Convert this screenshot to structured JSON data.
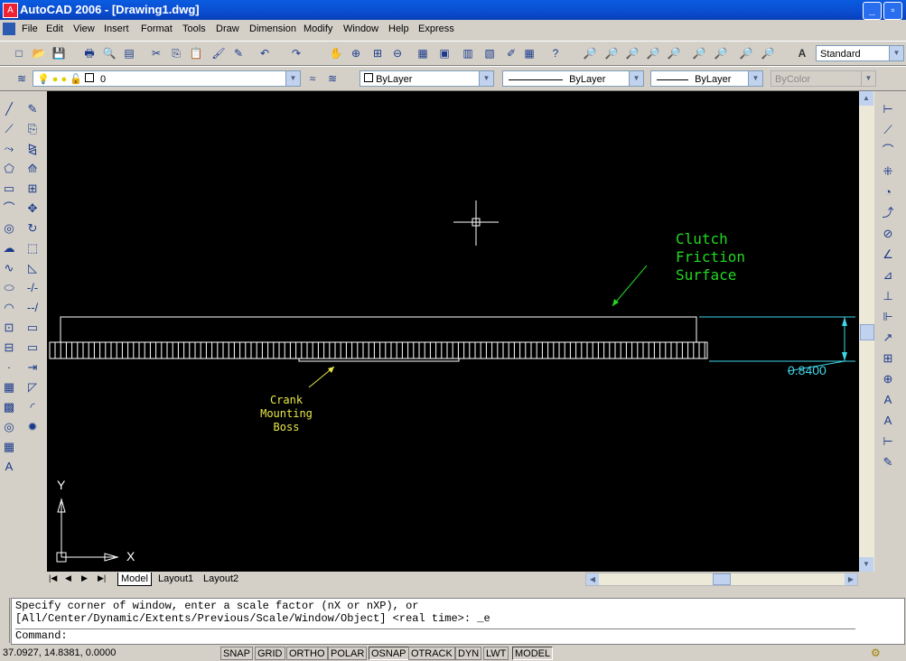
{
  "title": "AutoCAD 2006 - [Drawing1.dwg]",
  "menu": [
    "File",
    "Edit",
    "View",
    "Insert",
    "Format",
    "Tools",
    "Draw",
    "Dimension",
    "Modify",
    "Window",
    "Help",
    "Express"
  ],
  "text_style": "Standard",
  "layer": "0",
  "color": "ByLayer",
  "linetype": "ByLayer",
  "lineweight": "ByLayer",
  "plotstyle": "ByColor",
  "annotations": {
    "clutch": [
      "Clutch",
      "Friction",
      "Surface"
    ],
    "crank": [
      "Crank",
      "Mounting",
      "Boss"
    ],
    "dimension": "0.8400"
  },
  "ucs": {
    "x": "X",
    "y": "Y"
  },
  "tabs": [
    "Model",
    "Layout1",
    "Layout2"
  ],
  "command": {
    "line1": "Specify corner of window, enter a scale factor (nX or nXP), or",
    "line2": "[All/Center/Dynamic/Extents/Previous/Scale/Window/Object] <real time>: _e",
    "prompt": "Command:"
  },
  "coords": "37.0927, 14.8381, 0.0000",
  "status": [
    "SNAP",
    "GRID",
    "ORTHO",
    "POLAR",
    "OSNAP",
    "OTRACK",
    "DYN",
    "LWT",
    "MODEL"
  ],
  "colors": {
    "green": "#22d822",
    "yellow": "#e8e84a",
    "cyan": "#3fd6e8"
  },
  "icons": {
    "standard": [
      "new-icon",
      "open-icon",
      "save-icon",
      "plot-icon",
      "plot-preview-icon",
      "publish-icon",
      "cut-icon",
      "copy-icon",
      "paste-icon",
      "match-properties-icon",
      "block-editor-icon",
      "undo-icon",
      "redo-icon",
      "pan-icon",
      "zoom-realtime-icon",
      "zoom-window-icon",
      "zoom-previous-icon",
      "properties-icon",
      "design-center-icon",
      "tool-palettes-icon",
      "sheet-set-icon",
      "markup-icon",
      "calculator-icon",
      "help-icon"
    ],
    "draw": [
      "line-icon",
      "construction-line-icon",
      "polyline-icon",
      "polygon-icon",
      "rectangle-icon",
      "arc-icon",
      "circle-icon",
      "revision-cloud-icon",
      "spline-icon",
      "ellipse-icon",
      "ellipse-arc-icon",
      "insert-block-icon",
      "make-block-icon",
      "point-icon",
      "hatch-icon",
      "gradient-icon",
      "region-icon",
      "table-icon",
      "multiline-text-icon"
    ]
  }
}
